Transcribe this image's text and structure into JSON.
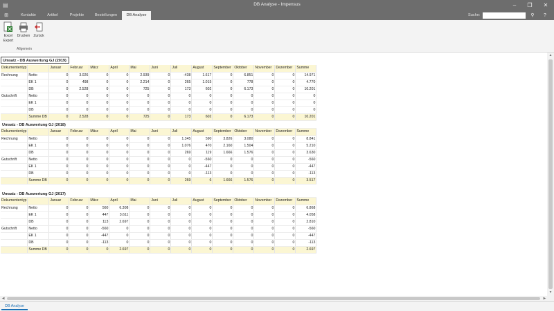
{
  "window": {
    "title": "DB Analyse - Impensus",
    "minimize": "–",
    "restore": "❐",
    "close": "✕"
  },
  "ribbon_tabs": [
    {
      "label": "Kontakte",
      "active": false
    },
    {
      "label": "Artikel",
      "active": false
    },
    {
      "label": "Projekte",
      "active": false
    },
    {
      "label": "Bestellungen",
      "active": false
    },
    {
      "label": "DB Analyse",
      "active": true
    }
  ],
  "search": {
    "label": "Suche:",
    "value": ""
  },
  "ribbon": {
    "buttons": [
      {
        "label1": "Excel",
        "label2": "Export",
        "icon": "excel-export-icon"
      },
      {
        "label1": "Drucken",
        "label2": "",
        "icon": "printer-icon"
      },
      {
        "label1": "Zurück",
        "label2": "",
        "icon": "back-icon"
      }
    ],
    "group_label": "Allgemein"
  },
  "columns": [
    "Dokumententyp",
    "",
    "Januar",
    "Februar",
    "März",
    "April",
    "Mai",
    "Juni",
    "Juli",
    "August",
    "September",
    "Oktober",
    "November",
    "Dezember",
    "Summe"
  ],
  "sections": [
    {
      "title": "Umsatz - DB Auswertung GJ (2019)",
      "rows": [
        {
          "type": "Rechnung",
          "kind": "Netto",
          "values": [
            "0",
            "3.026",
            "0",
            "0",
            "2.939",
            "0",
            "-438",
            "1.617",
            "0",
            "6.851",
            "0",
            "0",
            "14.971"
          ],
          "sum": false
        },
        {
          "type": "",
          "kind": "EK 1",
          "values": [
            "0",
            "498",
            "0",
            "0",
            "2.214",
            "0",
            "265",
            "1.015",
            "0",
            "778",
            "0",
            "0",
            "4.770"
          ],
          "sum": false
        },
        {
          "type": "",
          "kind": "DB",
          "values": [
            "0",
            "2.528",
            "0",
            "0",
            "725",
            "0",
            "173",
            "602",
            "0",
            "6.173",
            "0",
            "0",
            "10.201"
          ],
          "sum": false
        },
        {
          "type": "Gutschrift",
          "kind": "Netto",
          "values": [
            "0",
            "0",
            "0",
            "0",
            "0",
            "0",
            "0",
            "0",
            "0",
            "0",
            "0",
            "0",
            "0"
          ],
          "sum": false
        },
        {
          "type": "",
          "kind": "EK 1",
          "values": [
            "0",
            "0",
            "0",
            "0",
            "0",
            "0",
            "0",
            "0",
            "0",
            "0",
            "0",
            "0",
            "0"
          ],
          "sum": false
        },
        {
          "type": "",
          "kind": "DB",
          "values": [
            "0",
            "0",
            "0",
            "0",
            "0",
            "0",
            "0",
            "0",
            "0",
            "0",
            "0",
            "0",
            "0"
          ],
          "sum": false
        },
        {
          "type": "",
          "kind": "Summe DB",
          "values": [
            "0",
            "2.528",
            "0",
            "0",
            "725",
            "0",
            "173",
            "602",
            "0",
            "6.173",
            "0",
            "0",
            "10.201"
          ],
          "sum": true
        }
      ]
    },
    {
      "title": "Umsatz - DB Auswertung GJ (2018)",
      "rows": [
        {
          "type": "Rechnung",
          "kind": "Netto",
          "values": [
            "0",
            "0",
            "0",
            "0",
            "0",
            "0",
            "1.345",
            "590",
            "3.826",
            "3.080",
            "0",
            "0",
            "8.841"
          ],
          "sum": false
        },
        {
          "type": "",
          "kind": "EK 1",
          "values": [
            "0",
            "0",
            "0",
            "0",
            "0",
            "0",
            "1.076",
            "470",
            "2.160",
            "1.504",
            "0",
            "0",
            "5.210"
          ],
          "sum": false
        },
        {
          "type": "",
          "kind": "DB",
          "values": [
            "0",
            "0",
            "0",
            "0",
            "0",
            "0",
            "269",
            "119",
            "1.666",
            "1.576",
            "0",
            "0",
            "3.630"
          ],
          "sum": false
        },
        {
          "type": "Gutschrift",
          "kind": "Netto",
          "values": [
            "0",
            "0",
            "0",
            "0",
            "0",
            "0",
            "0",
            "-560",
            "0",
            "0",
            "0",
            "0",
            "-560"
          ],
          "sum": false
        },
        {
          "type": "",
          "kind": "EK 1",
          "values": [
            "0",
            "0",
            "0",
            "0",
            "0",
            "0",
            "0",
            "-447",
            "0",
            "0",
            "0",
            "0",
            "-447"
          ],
          "sum": false
        },
        {
          "type": "",
          "kind": "DB",
          "values": [
            "0",
            "0",
            "0",
            "0",
            "0",
            "0",
            "0",
            "-113",
            "0",
            "0",
            "0",
            "0",
            "-113"
          ],
          "sum": false
        },
        {
          "type": "",
          "kind": "Summe DB",
          "values": [
            "0",
            "0",
            "0",
            "0",
            "0",
            "0",
            "269",
            "6",
            "1.666",
            "1.576",
            "0",
            "0",
            "3.517"
          ],
          "sum": true
        }
      ]
    },
    {
      "title": "Umsatz - DB Auswertung GJ (2017)",
      "rows": [
        {
          "type": "Rechnung",
          "kind": "Netto",
          "values": [
            "0",
            "0",
            "560",
            "6.308",
            "0",
            "0",
            "0",
            "0",
            "0",
            "0",
            "0",
            "0",
            "6.868"
          ],
          "sum": false
        },
        {
          "type": "",
          "kind": "EK 1",
          "values": [
            "0",
            "0",
            "447",
            "3.611",
            "0",
            "0",
            "0",
            "0",
            "0",
            "0",
            "0",
            "0",
            "4.058"
          ],
          "sum": false
        },
        {
          "type": "",
          "kind": "DB",
          "values": [
            "0",
            "0",
            "113",
            "2.697",
            "0",
            "0",
            "0",
            "0",
            "0",
            "0",
            "0",
            "0",
            "2.810"
          ],
          "sum": false
        },
        {
          "type": "Gutschrift",
          "kind": "Netto",
          "values": [
            "0",
            "0",
            "-560",
            "0",
            "0",
            "0",
            "0",
            "0",
            "0",
            "0",
            "0",
            "0",
            "-560"
          ],
          "sum": false
        },
        {
          "type": "",
          "kind": "EK 1",
          "values": [
            "0",
            "0",
            "-447",
            "0",
            "0",
            "0",
            "0",
            "0",
            "0",
            "0",
            "0",
            "0",
            "-447"
          ],
          "sum": false
        },
        {
          "type": "",
          "kind": "DB",
          "values": [
            "0",
            "0",
            "-113",
            "0",
            "0",
            "0",
            "0",
            "0",
            "0",
            "0",
            "0",
            "0",
            "-113"
          ],
          "sum": false
        },
        {
          "type": "",
          "kind": "Summe DB",
          "values": [
            "0",
            "0",
            "0",
            "2.697",
            "0",
            "0",
            "0",
            "0",
            "0",
            "0",
            "0",
            "0",
            "2.697"
          ],
          "sum": true
        }
      ]
    }
  ],
  "bottom_tab": "DB Analyse",
  "colors": {
    "titlebar": "#6d6d6d",
    "header_fill": "#fbf6d3",
    "accent": "#1a6fb5"
  }
}
